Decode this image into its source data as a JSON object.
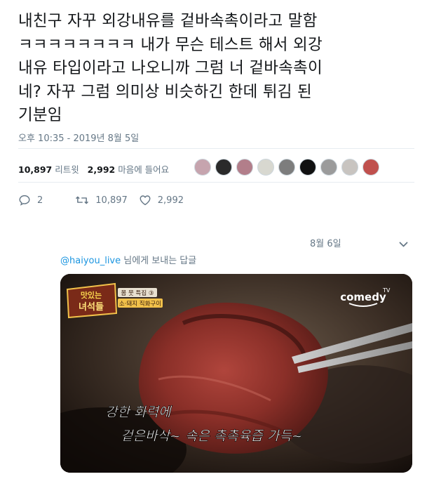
{
  "tweet": {
    "text": "내친구 자꾸 외강내유를 겉바속촉이라고 말함\nㅋㅋㅋㅋㅋㅋㅋㅋ 내가 무슨 테스트 해서 외강\n내유 타입이라고 나오니까 그럼 너 겉바속촉이\n네? 자꾸 그럼 의미상 비슷하긴 한데 튀김 된\n기분임",
    "timestamp": "오후 10:35 - 2019년 8월 5일"
  },
  "stats": {
    "retweets_count": "10,897",
    "retweets_label": "리트윗",
    "likes_count": "2,992",
    "likes_label": "마음에 들어요"
  },
  "liker_avatars": [
    {
      "color": "#c6a4ae"
    },
    {
      "color": "#2a2a2a"
    },
    {
      "color": "#b27e8a"
    },
    {
      "color": "#d8d8d0"
    },
    {
      "color": "#7d7d7d"
    },
    {
      "color": "#111111"
    },
    {
      "color": "#9b9b9b"
    },
    {
      "color": "#c8c4c0"
    },
    {
      "color": "#c0504d"
    }
  ],
  "actions": {
    "replies": "2",
    "retweets": "10,897",
    "likes": "2,992"
  },
  "reply": {
    "date": "8월 6일",
    "handle": "@haiyou_live",
    "replying_to_suffix": " 님에게 보내는 답글",
    "media": {
      "show_logo_top": "맛있는",
      "show_logo_bottom": "녀석들",
      "episode_line1": "몸 뭇 특집 ③",
      "episode_line2": "소·돼지 직화구이",
      "channel": "comedy",
      "channel_tv": "TV",
      "caption_line1": "강한 화력에",
      "caption_line2": "겉은바삭~ 속은 촉촉육즙 가득~"
    }
  },
  "colors": {
    "text_primary": "#14171a",
    "text_secondary": "#657786",
    "link": "#1b95e0",
    "divider": "#e6ecf0"
  }
}
